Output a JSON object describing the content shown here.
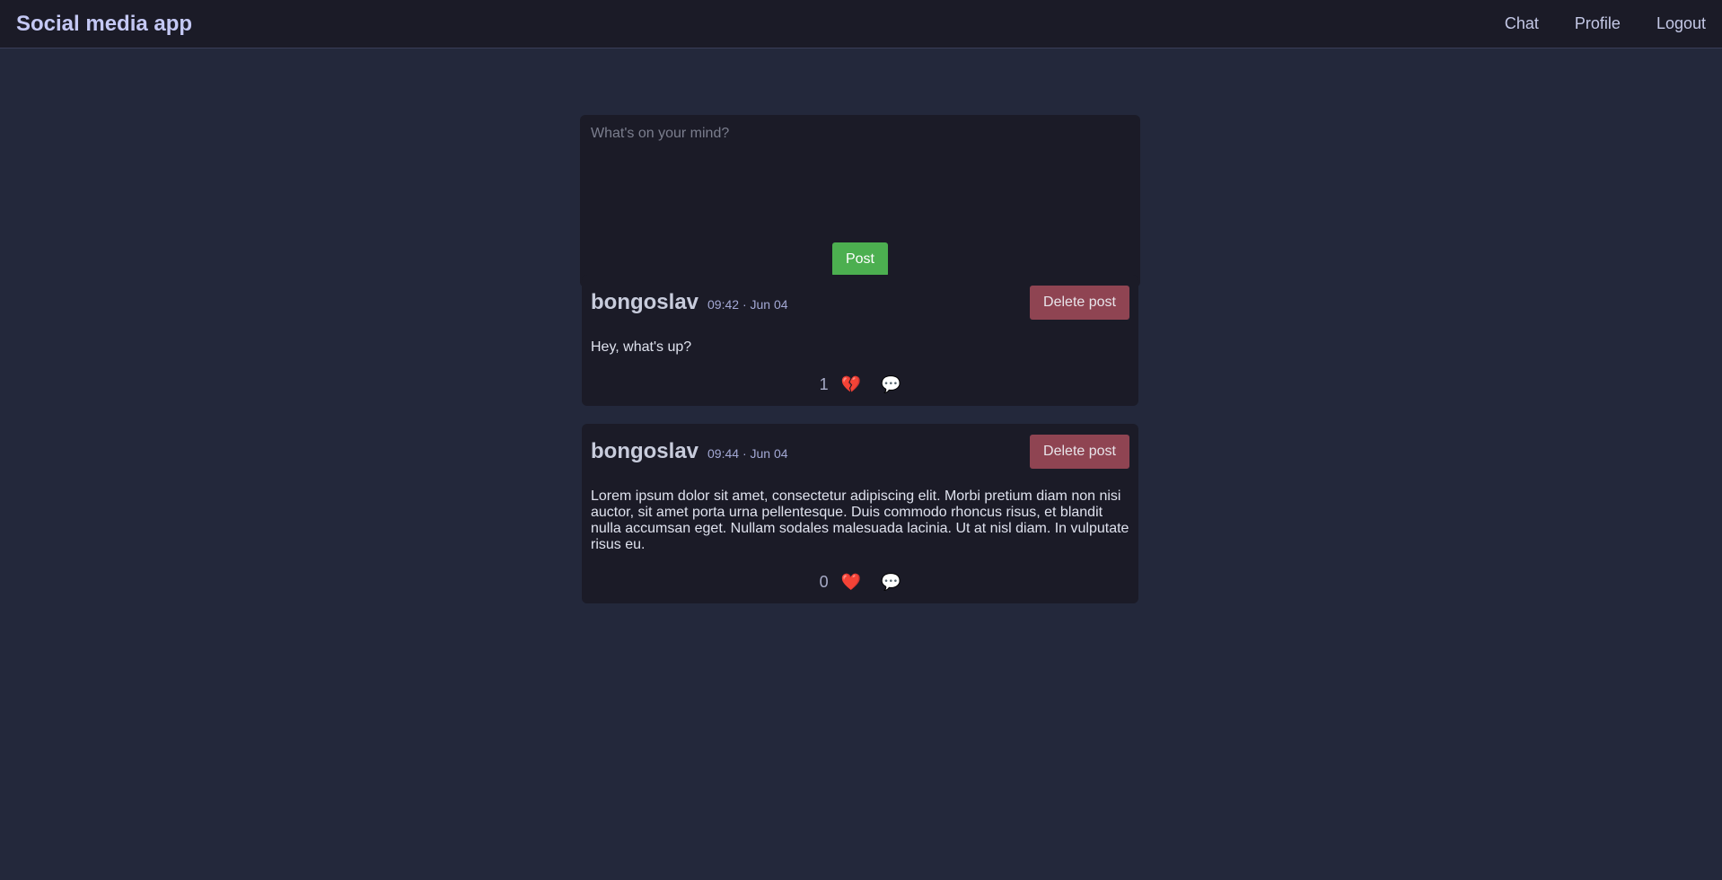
{
  "navbar": {
    "brand": "Social media app",
    "links": [
      {
        "label": "Chat"
      },
      {
        "label": "Profile"
      },
      {
        "label": "Logout"
      }
    ]
  },
  "composer": {
    "placeholder": "What's on your mind?",
    "value": "",
    "post_label": "Post"
  },
  "posts": [
    {
      "author": "bongoslav",
      "timestamp": "09:42 · Jun 04",
      "delete_label": "Delete post",
      "body": "Hey, what's up?",
      "likes": "1",
      "liked_icon": "broken-heart-icon",
      "comment_icon": "speech-bubble-icon"
    },
    {
      "author": "bongoslav",
      "timestamp": "09:44 · Jun 04",
      "delete_label": "Delete post",
      "body": "Lorem ipsum dolor sit amet, consectetur adipiscing elit. Morbi pretium diam non nisi auctor, sit amet porta urna pellentesque. Duis commodo rhoncus risus, et blandit nulla accumsan eget. Nullam sodales malesuada lacinia. Ut at nisl diam. In vulputate risus eu.",
      "likes": "0",
      "liked_icon": "heart-icon",
      "comment_icon": "speech-bubble-icon"
    }
  ],
  "colors": {
    "background": "#23283b",
    "panel": "#1b1b27",
    "post_button": "#4caf50",
    "delete_button": "#8f4452",
    "heart": "#f0383a"
  }
}
